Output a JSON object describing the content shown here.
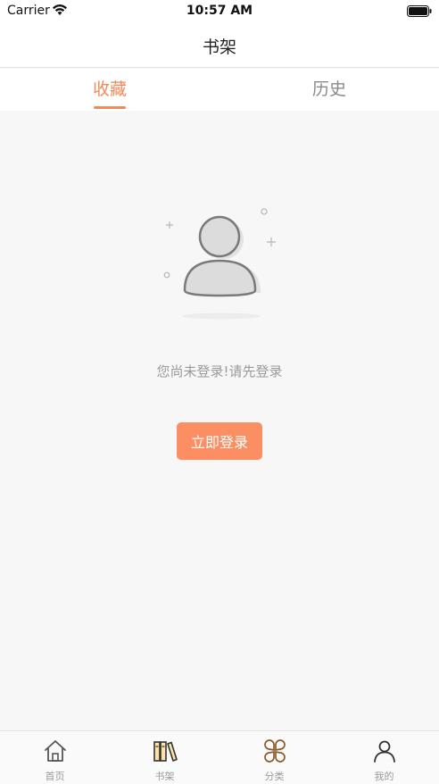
{
  "status_bar": {
    "carrier": "Carrier",
    "time": "10:57 AM"
  },
  "nav": {
    "title": "书架"
  },
  "tabs": [
    {
      "label": "收藏",
      "active": true
    },
    {
      "label": "历史",
      "active": false
    }
  ],
  "empty_state": {
    "message": "您尚未登录!请先登录",
    "icon": "user-placeholder-icon"
  },
  "login_button": {
    "label": "立即登录"
  },
  "tab_bar": {
    "items": [
      {
        "label": "首页",
        "icon": "home-icon",
        "active": false
      },
      {
        "label": "书架",
        "icon": "bookshelf-icon",
        "active": true
      },
      {
        "label": "分类",
        "icon": "category-icon",
        "active": false
      },
      {
        "label": "我的",
        "icon": "profile-icon",
        "active": false
      }
    ]
  },
  "colors": {
    "accent": "#f08a5d",
    "button": "#fb8e63",
    "background": "#f7f7f7",
    "tab_bar_icon": "#8a5a2a"
  }
}
